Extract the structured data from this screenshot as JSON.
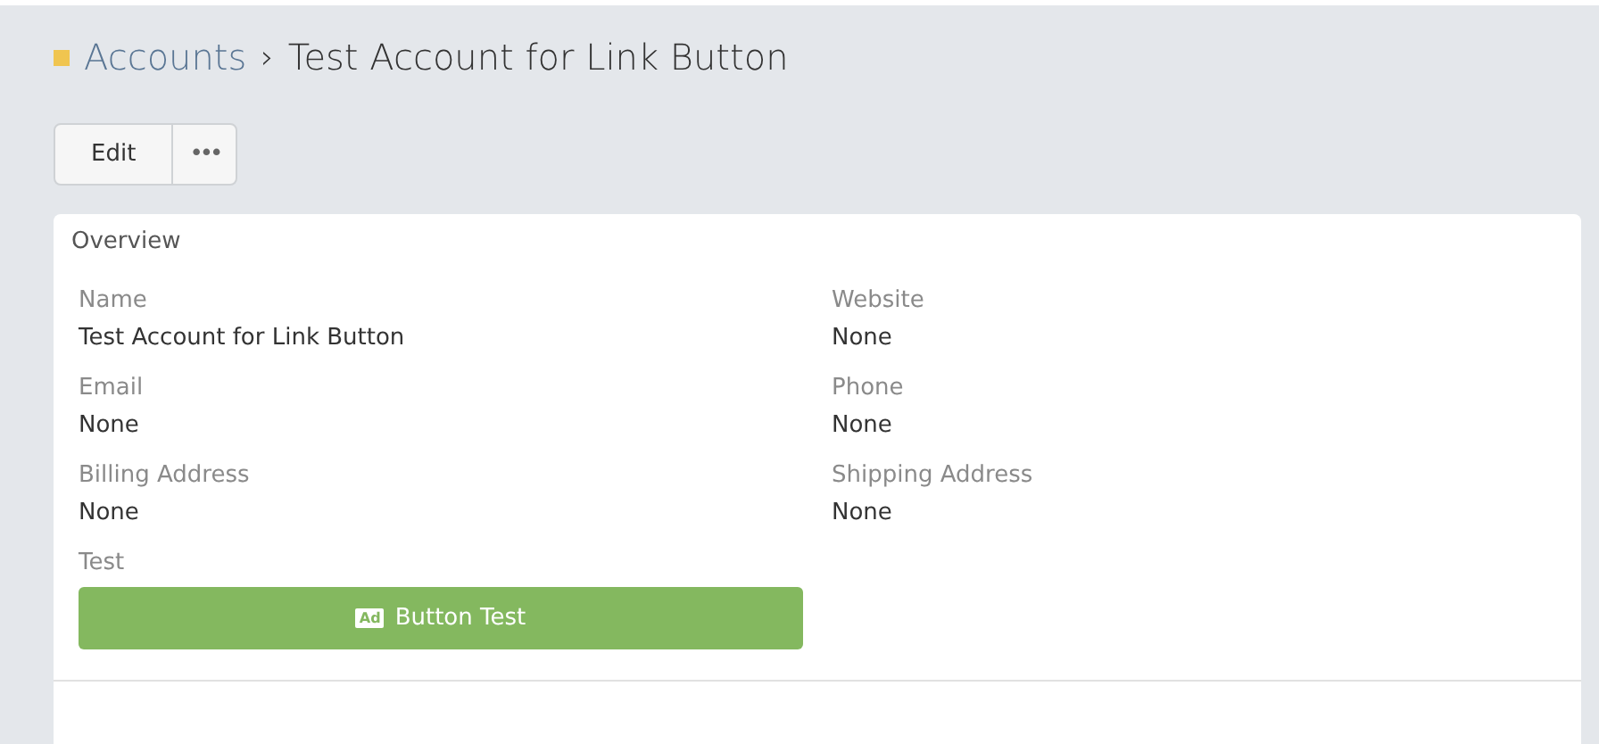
{
  "breadcrumb": {
    "parent": "Accounts",
    "separator": "›",
    "current": "Test Account for Link Button"
  },
  "actions": [
    {
      "kind": "text",
      "label": "Edit"
    },
    {
      "kind": "more",
      "label": "•••"
    }
  ],
  "panel": {
    "title": "Overview",
    "fields": [
      {
        "kind": "text",
        "label": "Name",
        "value": "Test Account for Link Button"
      },
      {
        "kind": "text",
        "label": "Website",
        "value": "None"
      },
      {
        "kind": "text",
        "label": "Email",
        "value": "None"
      },
      {
        "kind": "text",
        "label": "Phone",
        "value": "None"
      },
      {
        "kind": "text",
        "label": "Billing Address",
        "value": "None"
      },
      {
        "kind": "text",
        "label": "Shipping Address",
        "value": "None"
      },
      {
        "kind": "button",
        "label": "Test",
        "badge": "Ad",
        "value": "Button Test"
      }
    ]
  }
}
